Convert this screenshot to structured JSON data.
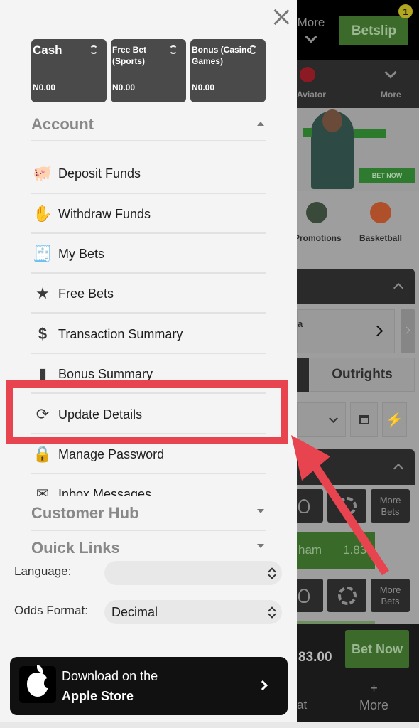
{
  "background_app": {
    "header": {
      "more_label": "More",
      "betslip_label": "Betslip",
      "betslip_count": "1"
    },
    "nav": {
      "aviator_label": "Aviator",
      "more_label": "More"
    },
    "banner": {
      "button_label": "BET NOW"
    },
    "categories": [
      {
        "label": "Promotions",
        "icon": "megaphone-icon"
      },
      {
        "label": "Basketball",
        "icon": "basketball-icon"
      }
    ],
    "league_row_text": "a",
    "tabs": {
      "outrights_label": "Outrights"
    },
    "markets": {
      "more_bets_label": "More Bets",
      "selection_text": "ham",
      "selection_odds": "1.83"
    },
    "betslip_bar": {
      "stake": "83.00",
      "bet_now_label": "Bet Now",
      "chat_label": "at",
      "more_label": "More",
      "plus": "+"
    }
  },
  "drawer": {
    "wallets": [
      {
        "title": "Cash",
        "amount": "N0.00"
      },
      {
        "title": "Free Bet (Sports)",
        "amount": "N0.00"
      },
      {
        "title": "Bonus (Casino Games)",
        "amount": "N0.00"
      }
    ],
    "sections": {
      "account": "Account",
      "customer_hub": "Customer Hub",
      "quick_links": "Quick Links"
    },
    "account_items": [
      {
        "label": "Deposit Funds",
        "icon": "piggy-bank-icon"
      },
      {
        "label": "Withdraw Funds",
        "icon": "money-hand-icon"
      },
      {
        "label": "My Bets",
        "icon": "receipt-icon"
      },
      {
        "label": "Free Bets",
        "icon": "star-icon"
      },
      {
        "label": "Transaction Summary",
        "icon": "dollar-exchange-icon"
      },
      {
        "label": "Bonus Summary",
        "icon": "document-icon"
      },
      {
        "label": "Update Details",
        "icon": "sync-icon"
      },
      {
        "label": "Manage Password",
        "icon": "lock-icon"
      },
      {
        "label": "Inbox Messages",
        "icon": "envelope-icon"
      }
    ],
    "settings": {
      "language_label": "Language:",
      "language_value": "",
      "odds_format_label": "Odds Format:",
      "odds_format_value": "Decimal"
    },
    "app_store": {
      "line1": "Download on the",
      "line2": "Apple Store"
    }
  },
  "annotation": {
    "highlight_color": "#e84450",
    "highlighted_item": "Update Details"
  }
}
